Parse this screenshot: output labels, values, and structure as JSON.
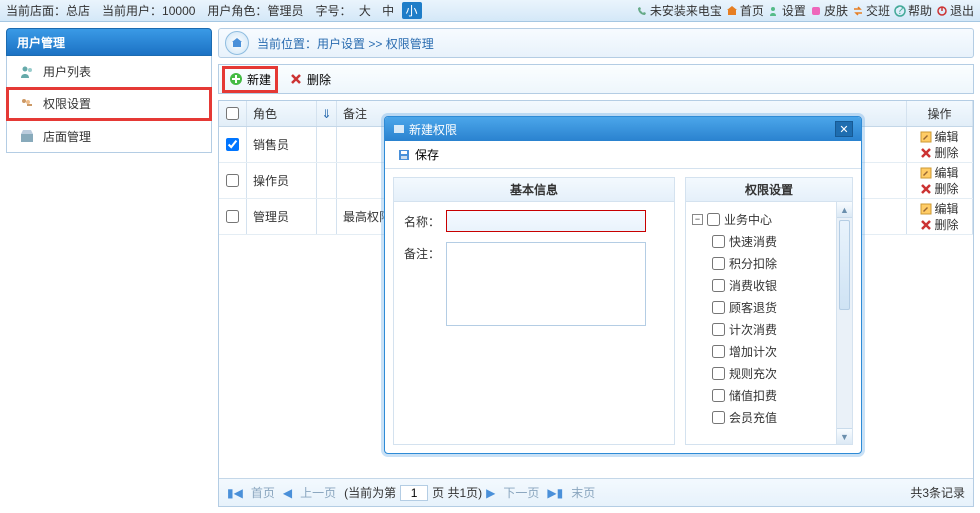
{
  "topbar": {
    "store_label": "当前店面：",
    "store_value": "总店",
    "user_label": "当前用户：",
    "user_value": "10000",
    "role_label": "用户角色：",
    "role_value": "管理员",
    "font_label": "字号：",
    "size_large": "大",
    "size_medium": "中",
    "size_small": "小",
    "not_installed": "未安装来电宝",
    "home": "首页",
    "settings": "设置",
    "skin": "皮肤",
    "shift": "交班",
    "help": "帮助",
    "logout": "退出"
  },
  "sidebar": {
    "title": "用户管理",
    "items": [
      {
        "label": "用户列表",
        "icon": "users-icon"
      },
      {
        "label": "权限设置",
        "icon": "key-icon"
      },
      {
        "label": "店面管理",
        "icon": "store-icon"
      }
    ]
  },
  "breadcrumb": {
    "prefix": "当前位置：",
    "p1": "用户设置",
    "sep": " >> ",
    "p2": "权限管理"
  },
  "toolbar": {
    "new_label": "新建",
    "delete_label": "删除"
  },
  "grid": {
    "headers": {
      "role": "角色",
      "note": "备注",
      "op": "操作",
      "sort": "⇓"
    },
    "rows": [
      {
        "checked": true,
        "role": "销售员",
        "note": ""
      },
      {
        "checked": false,
        "role": "操作员",
        "note": ""
      },
      {
        "checked": false,
        "role": "管理员",
        "note": "最高权限"
      }
    ],
    "op_edit": "编辑",
    "op_delete": "删除",
    "pager": {
      "first": "首页",
      "prev": "上一页",
      "mid_prefix": "(当前为第",
      "mid_suffix": "页  共1页)",
      "page": "1",
      "next": "下一页",
      "last": "末页",
      "count": "共3条记录"
    }
  },
  "dialog": {
    "title": "新建权限",
    "save": "保存",
    "left_title": "基本信息",
    "right_title": "权限设置",
    "name_label": "名称：",
    "note_label": "备注：",
    "name_value": "",
    "note_value": "",
    "tree_root": "业务中心",
    "tree_items": [
      "快速消费",
      "积分扣除",
      "消费收银",
      "顾客退货",
      "计次消费",
      "增加计次",
      "规则充次",
      "储值扣费",
      "会员充值"
    ]
  },
  "colors": {
    "accent": "#1e7dc8",
    "hl": "#e53935"
  }
}
